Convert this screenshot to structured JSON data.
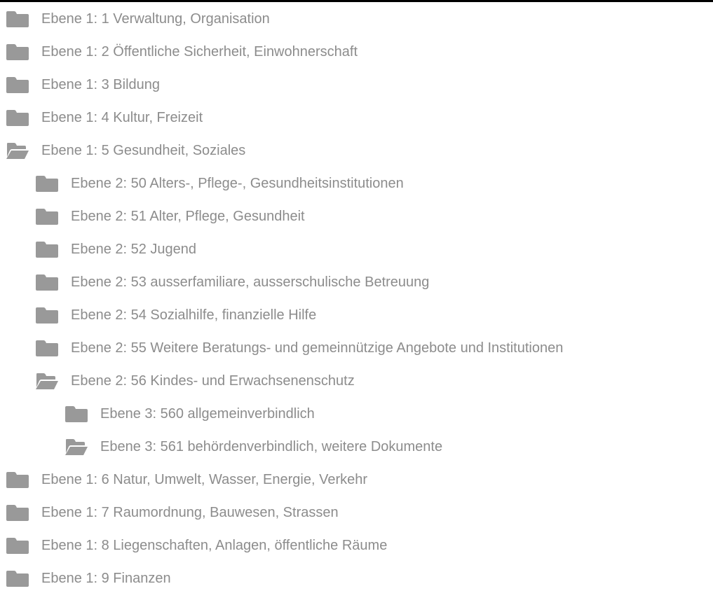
{
  "colors": {
    "folder_icon": "#999999",
    "label_text": "#8c8c8c",
    "top_rule": "#000000"
  },
  "tree": [
    {
      "level": 1,
      "expanded": false,
      "icon": "folder-icon",
      "label": "Ebene 1: 1 Verwaltung, Organisation"
    },
    {
      "level": 1,
      "expanded": false,
      "icon": "folder-icon",
      "label": "Ebene 1: 2 Öffentliche Sicherheit, Einwohnerschaft"
    },
    {
      "level": 1,
      "expanded": false,
      "icon": "folder-icon",
      "label": "Ebene 1: 3 Bildung"
    },
    {
      "level": 1,
      "expanded": false,
      "icon": "folder-icon",
      "label": "Ebene 1: 4 Kultur, Freizeit"
    },
    {
      "level": 1,
      "expanded": true,
      "icon": "folder-open-icon",
      "label": "Ebene 1: 5 Gesundheit, Soziales"
    },
    {
      "level": 2,
      "expanded": false,
      "icon": "folder-icon",
      "label": "Ebene 2: 50 Alters-, Pflege-, Gesundheitsinstitutionen"
    },
    {
      "level": 2,
      "expanded": false,
      "icon": "folder-icon",
      "label": "Ebene 2: 51 Alter, Pflege, Gesundheit"
    },
    {
      "level": 2,
      "expanded": false,
      "icon": "folder-icon",
      "label": "Ebene 2: 52 Jugend"
    },
    {
      "level": 2,
      "expanded": false,
      "icon": "folder-icon",
      "label": "Ebene 2: 53 ausserfamiliare, ausserschulische Betreuung"
    },
    {
      "level": 2,
      "expanded": false,
      "icon": "folder-icon",
      "label": "Ebene 2: 54 Sozialhilfe, finanzielle Hilfe"
    },
    {
      "level": 2,
      "expanded": false,
      "icon": "folder-icon",
      "label": "Ebene 2: 55 Weitere Beratungs- und gemeinnützige Angebote und Institutionen"
    },
    {
      "level": 2,
      "expanded": true,
      "icon": "folder-open-icon",
      "label": "Ebene 2: 56 Kindes- und Erwachsenenschutz"
    },
    {
      "level": 3,
      "expanded": false,
      "icon": "folder-icon",
      "label": "Ebene 3: 560 allgemeinverbindlich"
    },
    {
      "level": 3,
      "expanded": true,
      "icon": "folder-open-icon",
      "label": "Ebene 3: 561 behördenverbindlich, weitere Dokumente"
    },
    {
      "level": 1,
      "expanded": false,
      "icon": "folder-icon",
      "label": "Ebene 1: 6 Natur, Umwelt, Wasser, Energie, Verkehr"
    },
    {
      "level": 1,
      "expanded": false,
      "icon": "folder-icon",
      "label": "Ebene 1: 7 Raumordnung, Bauwesen, Strassen"
    },
    {
      "level": 1,
      "expanded": false,
      "icon": "folder-icon",
      "label": "Ebene 1: 8 Liegenschaften, Anlagen, öffentliche Räume"
    },
    {
      "level": 1,
      "expanded": false,
      "icon": "folder-icon",
      "label": "Ebene 1: 9 Finanzen"
    }
  ]
}
